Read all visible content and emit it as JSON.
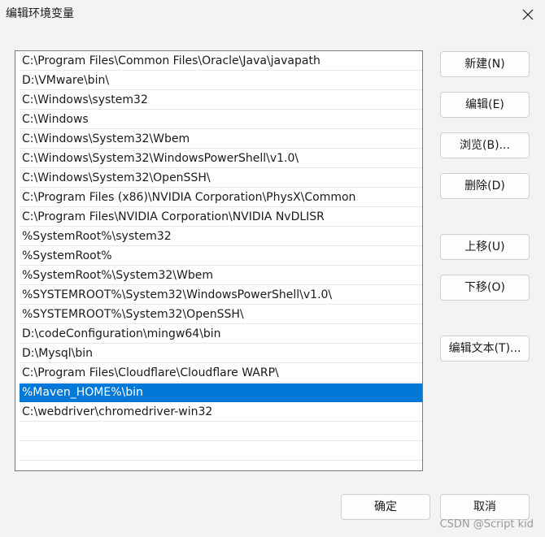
{
  "window": {
    "title": "编辑环境变量"
  },
  "icons": {
    "close": "close-icon"
  },
  "path_list": {
    "selected_index": 17,
    "items": [
      "C:\\Program Files\\Common Files\\Oracle\\Java\\javapath",
      "D:\\VMware\\bin\\",
      "C:\\Windows\\system32",
      "C:\\Windows",
      "C:\\Windows\\System32\\Wbem",
      "C:\\Windows\\System32\\WindowsPowerShell\\v1.0\\",
      "C:\\Windows\\System32\\OpenSSH\\",
      "C:\\Program Files (x86)\\NVIDIA Corporation\\PhysX\\Common",
      "C:\\Program Files\\NVIDIA Corporation\\NVIDIA NvDLISR",
      "%SystemRoot%\\system32",
      "%SystemRoot%",
      "%SystemRoot%\\System32\\Wbem",
      "%SYSTEMROOT%\\System32\\WindowsPowerShell\\v1.0\\",
      "%SYSTEMROOT%\\System32\\OpenSSH\\",
      "D:\\codeConfiguration\\mingw64\\bin",
      "D:\\Mysql\\bin",
      "C:\\Program Files\\Cloudflare\\Cloudflare WARP\\",
      "%Maven_HOME%\\bin",
      "C:\\webdriver\\chromedriver-win32"
    ]
  },
  "buttons": {
    "new": "新建(N)",
    "edit": "编辑(E)",
    "browse": "浏览(B)...",
    "delete": "删除(D)",
    "move_up": "上移(U)",
    "move_down": "下移(O)",
    "edit_text": "编辑文本(T)...",
    "ok": "确定",
    "cancel": "取消"
  },
  "watermark": "CSDN @Script kid",
  "colors": {
    "selection": "#0078d7",
    "background": "#f3f3f3"
  }
}
